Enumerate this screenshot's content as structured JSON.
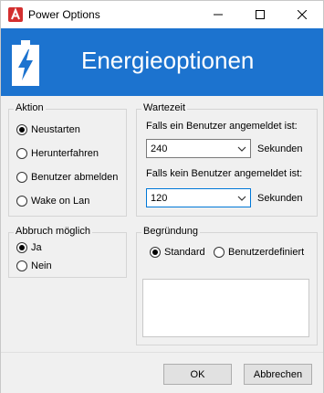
{
  "window": {
    "title": "Power Options"
  },
  "banner": {
    "title": "Energieoptionen"
  },
  "aktion": {
    "label": "Aktion",
    "options": [
      "Neustarten",
      "Herunterfahren",
      "Benutzer abmelden",
      "Wake on Lan"
    ],
    "selected": "Neustarten"
  },
  "wartezeit": {
    "label": "Wartezeit",
    "logged_in_label": "Falls ein Benutzer angemeldet ist:",
    "logged_in_value": "240",
    "logged_out_label": "Falls kein Benutzer angemeldet ist:",
    "logged_out_value": "120",
    "unit": "Sekunden"
  },
  "abbruch": {
    "label": "Abbruch möglich",
    "options": [
      "Ja",
      "Nein"
    ],
    "selected": "Ja"
  },
  "begruendung": {
    "label": "Begründung",
    "options": [
      "Standard",
      "Benutzerdefiniert"
    ],
    "selected": "Standard",
    "text": ""
  },
  "buttons": {
    "ok": "OK",
    "cancel": "Abbrechen"
  },
  "colors": {
    "banner": "#1c73cf",
    "focus": "#0078d7",
    "app_icon": "#d32f2f"
  },
  "icons": {
    "app": "red-a-app-icon",
    "banner": "battery-charging-icon"
  }
}
